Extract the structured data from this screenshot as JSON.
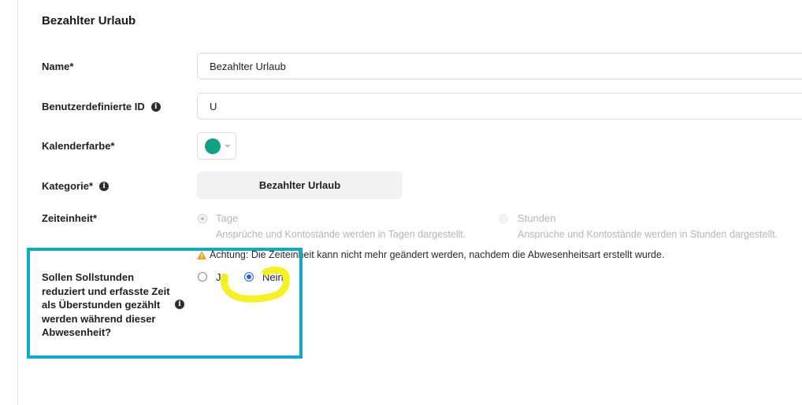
{
  "section": {
    "title": "Bezahlter Urlaub"
  },
  "fields": {
    "name": {
      "label": "Name*",
      "value": "Bezahlter Urlaub"
    },
    "custom_id": {
      "label": "Benutzerdefinierte ID",
      "value": "U"
    },
    "calendar_color": {
      "label": "Kalenderfarbe*",
      "color": "#14a085"
    },
    "category": {
      "label": "Kategorie*",
      "value": "Bezahlter Urlaub"
    },
    "time_unit": {
      "label": "Zeiteinheit*",
      "options": [
        {
          "label": "Tage",
          "description": "Ansprüche und Kontostände werden in Tagen dargestellt.",
          "selected": true,
          "disabled": true
        },
        {
          "label": "Stunden",
          "description": "Ansprüche und Kontostände werden in Stunden dargestellt.",
          "selected": false,
          "disabled": true
        }
      ],
      "warning": "Achtung: Die Zeiteinheit kann nicht mehr geändert werden, nachdem die Abwesenheitsart erstellt wurde."
    },
    "reduce_hours": {
      "question": "Sollen Sollstunden reduziert und erfasste Zeit als Überstunden gezählt werden während dieser Abwesenheit?",
      "options": [
        {
          "label": "Ja",
          "selected": false
        },
        {
          "label": "Nein",
          "selected": true
        }
      ]
    }
  },
  "annotations": {
    "box_color": "#14a8c6",
    "scribble_color": "#f5ef1c"
  }
}
